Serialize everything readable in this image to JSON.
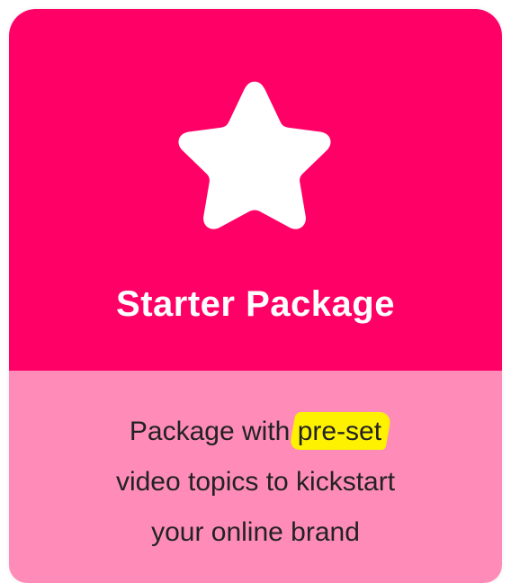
{
  "card": {
    "title": "Starter Package",
    "icon": "star-icon",
    "description": {
      "line1_before": "Package with ",
      "line1_highlight": "pre-set",
      "line2": "video topics to kickstart",
      "line3": "your online brand"
    },
    "colors": {
      "header": "#ff0066",
      "body": "#ff8cb8",
      "highlight": "#fff200"
    }
  }
}
